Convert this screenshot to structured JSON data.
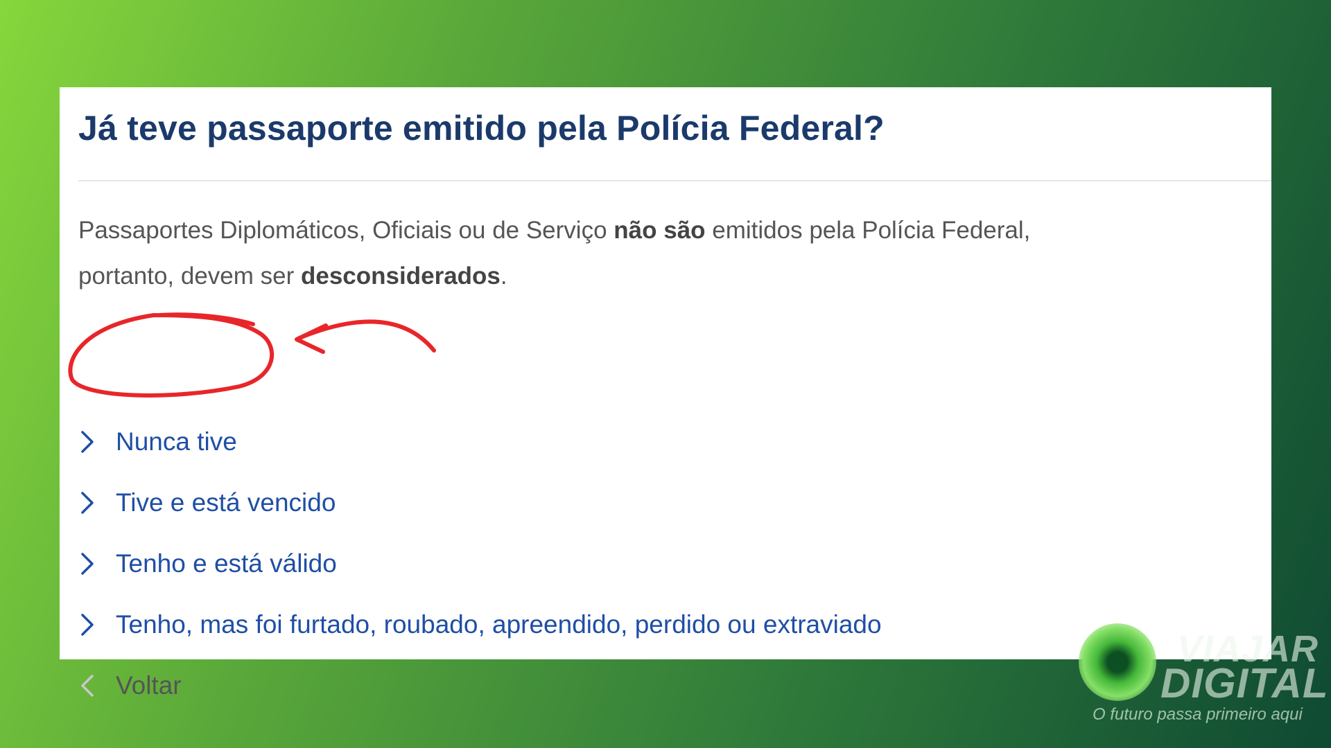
{
  "question": {
    "title": "Já teve passaporte emitido pela Polícia Federal?",
    "notice_before": "Passaportes Diplomáticos, Oficiais ou de Serviço ",
    "notice_bold_1": "não são",
    "notice_middle": " emitidos pela Polícia Federal, portanto, devem ser ",
    "notice_bold_2": "desconsiderados",
    "notice_after": "."
  },
  "options": [
    {
      "label": "Nunca tive",
      "icon": "chevron-right-icon"
    },
    {
      "label": "Tive e está vencido",
      "icon": "chevron-right-icon"
    },
    {
      "label": "Tenho e está válido",
      "icon": "chevron-right-icon"
    },
    {
      "label": "Tenho, mas foi furtado, roubado, apreendido, perdido ou extraviado",
      "icon": "chevron-right-icon"
    }
  ],
  "back": {
    "label": "Voltar",
    "icon": "chevron-left-icon"
  },
  "watermark": {
    "line1": "VIAJAR",
    "line2": "DIGITAL",
    "tagline": "O futuro passa primeiro aqui"
  },
  "colors": {
    "title": "#1b3a6b",
    "link": "#1f4ea5",
    "annotation": "#e8262a"
  }
}
